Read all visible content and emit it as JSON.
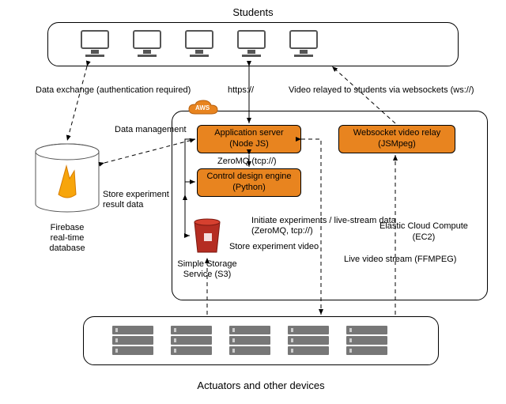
{
  "titles": {
    "students": "Students",
    "actuators": "Actuators and other devices"
  },
  "edges": {
    "data_exchange": "Data exchange (authentication required)",
    "https": "https://",
    "video_relay_ws": "Video relayed to students via websockets (ws://)",
    "data_mgmt": "Data management",
    "zeromq_tcp": "ZeroMQ (tcp://)",
    "store_result": "Store experiment\nresult data",
    "store_video": "Store experiment video",
    "initiate": "Initiate experiments / live-stream data\n(ZeroMQ, tcp://)",
    "live_video": "Live video stream (FFMPEG)"
  },
  "nodes": {
    "firebase": "Firebase\nreal-time\ndatabase",
    "app_server": {
      "l1": "Application server",
      "l2": "(Node JS)"
    },
    "control_engine": {
      "l1": "Control design engine",
      "l2": "(Python)"
    },
    "ws_relay": {
      "l1": "Websocket video relay",
      "l2": "(JSMpeg)"
    },
    "s3": "Simple Storage\nService (S3)",
    "ec2": "Elastic Cloud Compute\n(EC2)",
    "aws": "AWS"
  }
}
